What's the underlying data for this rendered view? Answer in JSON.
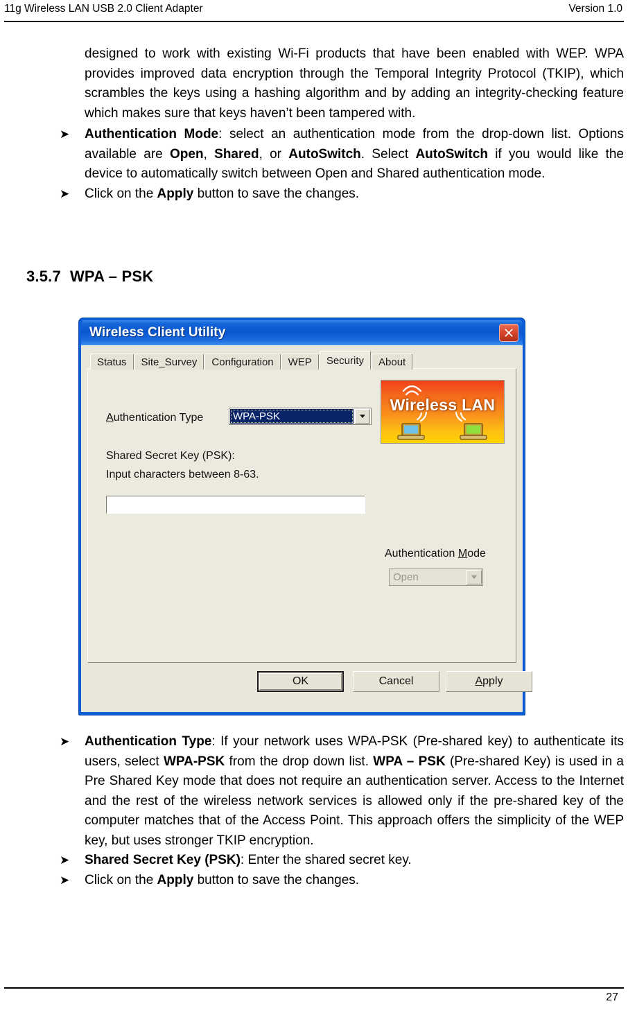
{
  "header": {
    "left": "11g Wireless LAN USB 2.0 Client Adapter",
    "right": "Version 1.0"
  },
  "intro_paragraph": "designed to work with existing Wi-Fi products that have been enabled with WEP.   WPA provides improved data encryption through the Temporal Integrity Protocol (TKIP), which scrambles the keys using a hashing algorithm and by adding an integrity-checking feature which makes sure that keys haven’t been tampered with.",
  "bullets_top": [
    {
      "glyph": "➤",
      "lead": "Authentication Mode",
      "rest": ": select an authentication mode from the drop-down list. Options available are ",
      "b1": "Open",
      "t1": ", ",
      "b2": "Shared",
      "t2": ", or ",
      "b3": "AutoSwitch",
      "t3": ".   Select ",
      "b4": "AutoSwitch",
      "t4": " if you would like the device to automatically switch between Open and Shared authentication mode."
    },
    {
      "glyph": "➤",
      "pre": "Click on the ",
      "bold": "Apply",
      "post": " button to save the changes."
    }
  ],
  "section": {
    "number": "3.5.7",
    "title": "WPA – PSK"
  },
  "dialog": {
    "title": "Wireless Client Utility",
    "close_icon": "close-icon",
    "tabs": [
      {
        "label": "Status",
        "active": false
      },
      {
        "label": "Site_Survey",
        "active": false
      },
      {
        "label": "Configuration",
        "active": false
      },
      {
        "label": "WEP",
        "active": false
      },
      {
        "label": "Security",
        "active": true
      },
      {
        "label": "About",
        "active": false
      }
    ],
    "auth_type": {
      "label_underlined": "A",
      "label_rest": "uthentication Type",
      "value": "WPA-PSK"
    },
    "psk": {
      "label_line1": "Shared Secret Key (PSK):",
      "label_line2": "Input characters between 8-63.",
      "value": "",
      "placeholder": ""
    },
    "auth_mode": {
      "label_pre": "Authentication ",
      "label_underlined": "M",
      "label_rest": "ode",
      "value": "Open",
      "enabled": false
    },
    "logo": {
      "text": "Wireless LAN",
      "color_start": "#f0401a",
      "color_end": "#ffd400"
    },
    "buttons": {
      "ok": "OK",
      "cancel": "Cancel",
      "apply_underlined": "A",
      "apply_rest": "pply"
    },
    "colors": {
      "titlebar_blue": "#0b56cf",
      "frame_blue": "#0a5fd8",
      "face": "#e9e6da",
      "select_blue": "#0a246a"
    }
  },
  "bullets_bottom": [
    {
      "glyph": "➤",
      "lead": "Authentication Type",
      "t0": ": If your network uses WPA-PSK (Pre-shared key) to authenticate its users, select ",
      "b1": "WPA-PSK",
      "t1": " from the drop down list. ",
      "b2": "WPA – PSK",
      "t2": " (Pre-shared Key) is used in a Pre Shared Key mode that does not require an authentication server.  Access to the Internet and the rest of the wireless network services is allowed only if the pre-shared key of the computer matches that of the Access Point.  This approach offers the simplicity of the WEP key, but uses stronger TKIP encryption."
    },
    {
      "glyph": "➤",
      "lead": "Shared Secret Key (PSK)",
      "rest": ": Enter the shared secret key."
    },
    {
      "glyph": "➤",
      "pre": "Click on the ",
      "bold": "Apply",
      "post": " button to save the changes."
    }
  ],
  "footer": {
    "page_number": "27"
  }
}
